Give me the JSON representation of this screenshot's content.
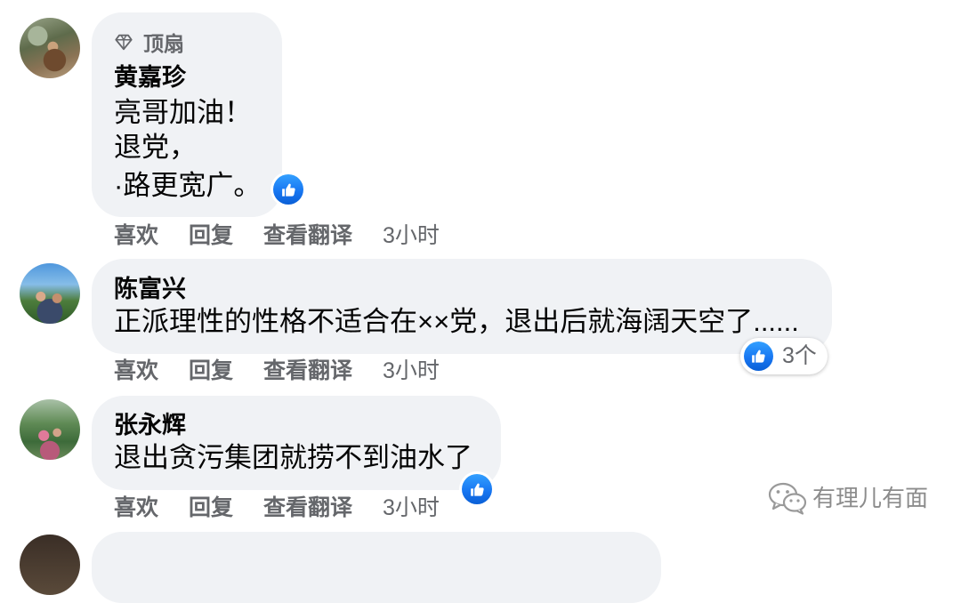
{
  "colors": {
    "bubble": "#f0f2f5",
    "text": "#050505",
    "secondary": "#65676b",
    "like": "#1877f2",
    "watermark": "#8c8c8c"
  },
  "comments": [
    {
      "badge": {
        "icon": "diamond-icon",
        "label": "顶扇"
      },
      "author": "黄嘉珍",
      "lines": [
        "亮哥加油！",
        "退党，",
        "·路更宽广。"
      ],
      "reaction": {
        "icon": "like-icon"
      },
      "actions": {
        "like": "喜欢",
        "reply": "回复",
        "translate": "查看翻译",
        "time": "3小时"
      }
    },
    {
      "author": "陈富兴",
      "lines": [
        "正派理性的性格不适合在××党，退出后就海阔天空了......"
      ],
      "reaction": {
        "icon": "like-icon",
        "count": "3个"
      },
      "actions": {
        "like": "喜欢",
        "reply": "回复",
        "translate": "查看翻译",
        "time": "3小时"
      }
    },
    {
      "author": "张永辉",
      "lines": [
        "退出贪污集团就捞不到油水了"
      ],
      "reaction": {
        "icon": "like-icon"
      },
      "actions": {
        "like": "喜欢",
        "reply": "回复",
        "translate": "查看翻译",
        "time": "3小时"
      }
    }
  ],
  "watermark": {
    "icon": "wechat-icon",
    "text": "有理儿有面"
  }
}
